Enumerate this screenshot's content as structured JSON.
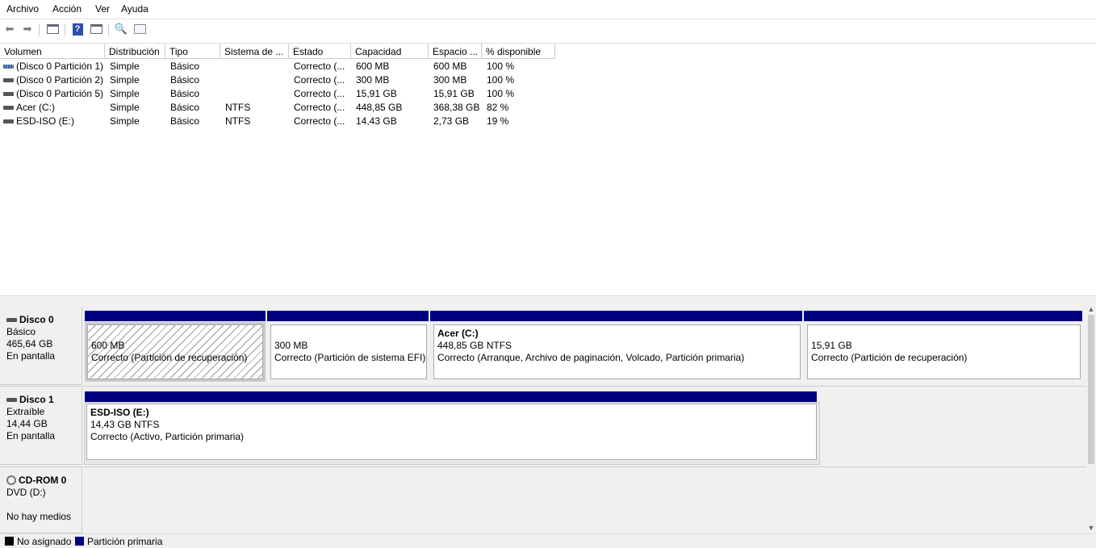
{
  "menu": [
    "Archivo",
    "Acción",
    "Ver",
    "Ayuda"
  ],
  "columns": [
    "Volumen",
    "Distribución",
    "Tipo",
    "Sistema de ...",
    "Estado",
    "Capacidad",
    "Espacio ...",
    "% disponible"
  ],
  "rows": [
    [
      "(Disco 0 Partición 1)",
      "Simple",
      "Básico",
      "",
      "Correcto (...",
      "600 MB",
      "600 MB",
      "100 %"
    ],
    [
      "(Disco 0 Partición 2)",
      "Simple",
      "Básico",
      "",
      "Correcto (...",
      "300 MB",
      "300 MB",
      "100 %"
    ],
    [
      "(Disco 0 Partición 5)",
      "Simple",
      "Básico",
      "",
      "Correcto (...",
      "15,91 GB",
      "15,91 GB",
      "100 %"
    ],
    [
      "Acer (C:)",
      "Simple",
      "Básico",
      "NTFS",
      "Correcto (...",
      "448,85 GB",
      "368,38 GB",
      "82 %"
    ],
    [
      "ESD-ISO (E:)",
      "Simple",
      "Básico",
      "NTFS",
      "Correcto (...",
      "14,43 GB",
      "2,73 GB",
      "19 %"
    ]
  ],
  "disks": [
    {
      "name": "Disco 0",
      "type": "Básico",
      "size": "465,64 GB",
      "status": "En pantalla",
      "partitions": [
        {
          "title": "",
          "size": "600 MB",
          "status": "Correcto (Partición de recuperación)"
        },
        {
          "title": "",
          "size": "300 MB",
          "status": "Correcto (Partición de sistema EFI)"
        },
        {
          "title": "Acer  (C:)",
          "size": "448,85 GB NTFS",
          "status": "Correcto (Arranque, Archivo de paginación, Volcado, Partición primaria)"
        },
        {
          "title": "",
          "size": "15,91 GB",
          "status": "Correcto (Partición de recuperación)"
        }
      ]
    },
    {
      "name": "Disco 1",
      "type": "Extraíble",
      "size": "14,44 GB",
      "status": "En pantalla",
      "partitions": [
        {
          "title": "ESD-ISO  (E:)",
          "size": "14,43 GB NTFS",
          "status": "Correcto (Activo, Partición primaria)"
        }
      ]
    },
    {
      "name": "CD-ROM 0",
      "type": "DVD (D:)",
      "size": "",
      "status": "No hay medios"
    }
  ],
  "legend": [
    {
      "label": "No asignado",
      "color": "#000000"
    },
    {
      "label": "Partición primaria",
      "color": "#000080"
    }
  ]
}
